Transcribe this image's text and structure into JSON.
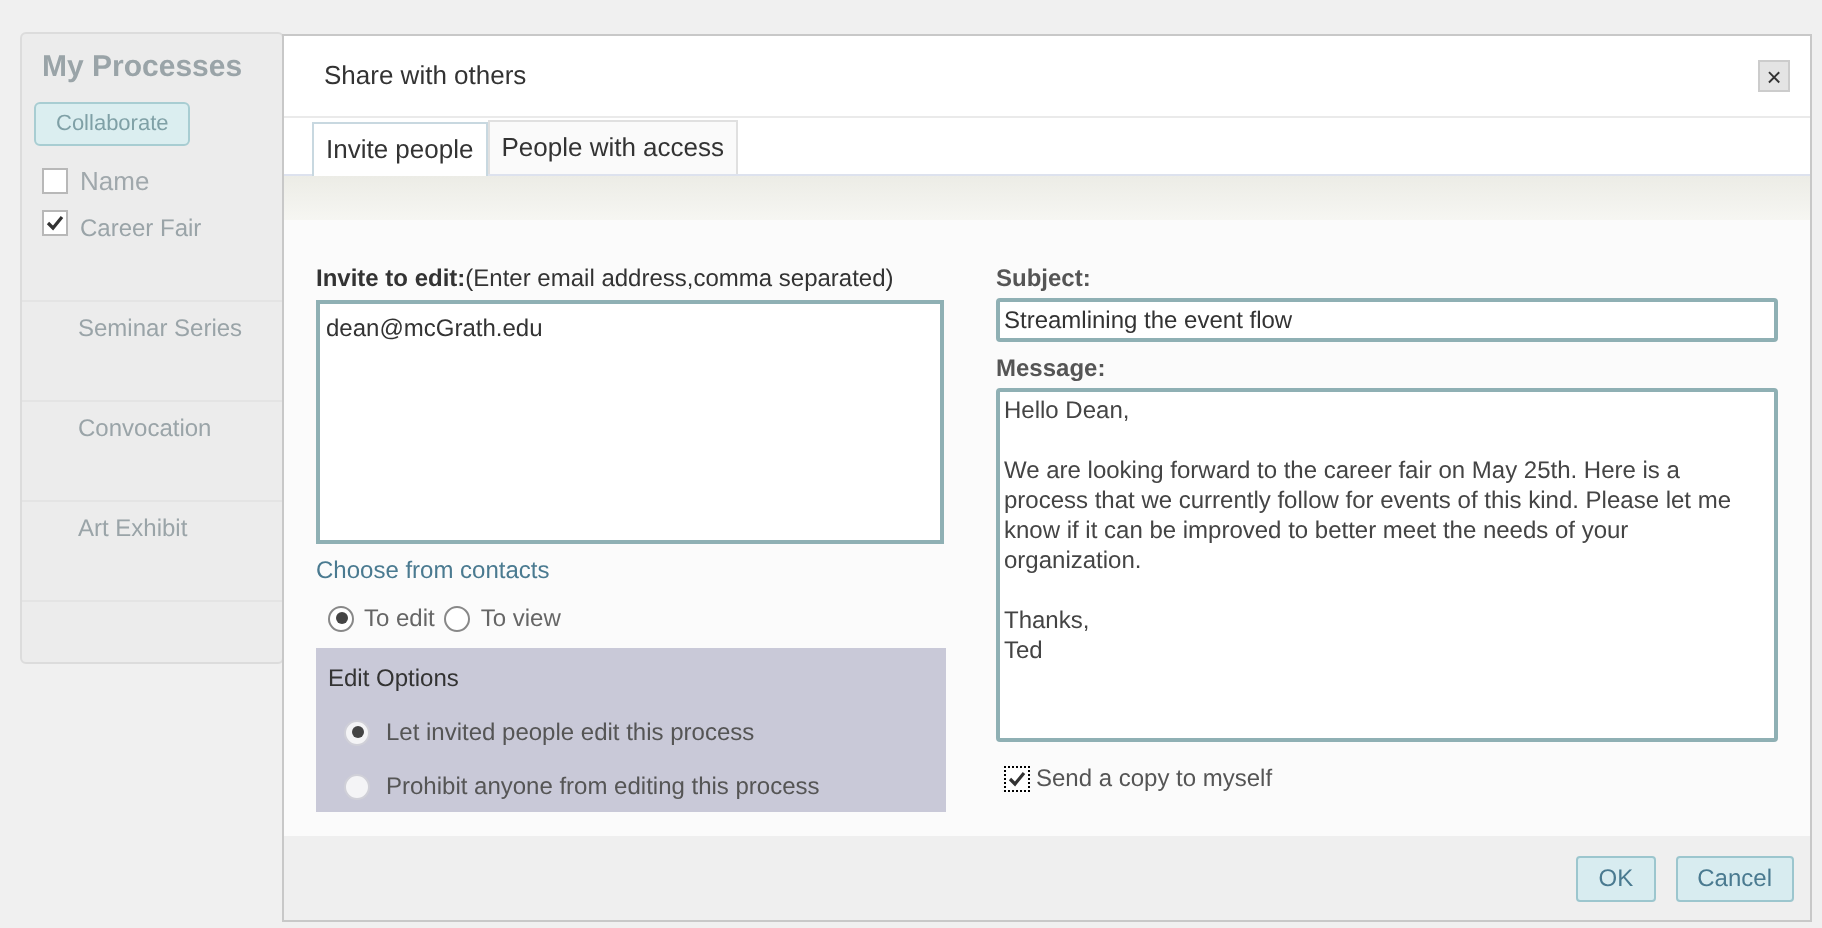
{
  "sidebar": {
    "title": "My Processes",
    "button": "Collaborate",
    "header": {
      "label": "Name",
      "checked": false
    },
    "rows": [
      {
        "name": "Career Fair",
        "checked": true
      },
      {
        "name": "Seminar Series"
      },
      {
        "name": "Convocation"
      },
      {
        "name": "Art Exhibit"
      }
    ]
  },
  "dialog": {
    "title": "Share with others",
    "close": "×",
    "tabs": [
      {
        "label": "Invite people",
        "selected": true
      },
      {
        "label": "People with access",
        "selected": false
      }
    ],
    "invite": {
      "label": "Invite to edit:",
      "hint": "(Enter email address,comma separated)",
      "value": "dean@mcGrath.edu"
    },
    "contacts_link": "Choose from contacts",
    "access": [
      {
        "label": "To edit",
        "selected": true
      },
      {
        "label": "To view",
        "selected": false
      }
    ],
    "edit_options": {
      "title": "Edit Options",
      "options": [
        {
          "label": "Let invited people edit this process",
          "selected": true
        },
        {
          "label": "Prohibit anyone from editing this process",
          "selected": false
        }
      ]
    },
    "subject": {
      "label": "Subject:",
      "value": "Streamlining the event flow"
    },
    "message": {
      "label": "Message:",
      "value": "Hello Dean,\n\nWe are looking forward to the career fair on May 25th. Here is a process that we currently follow for events of this kind. Please let me know if it can be improved to better meet the needs of your organization.\n\nThanks,\nTed"
    },
    "copy": {
      "label": "Send a copy to myself",
      "checked": true
    },
    "buttons": [
      "OK",
      "Cancel"
    ]
  }
}
